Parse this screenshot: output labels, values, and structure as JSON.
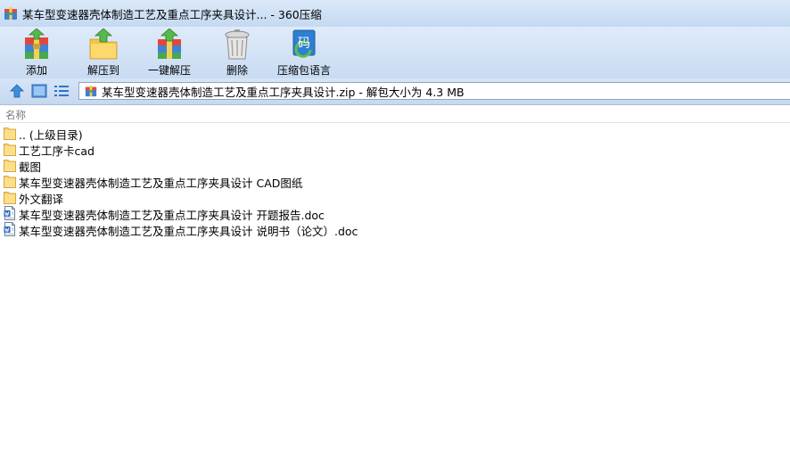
{
  "window": {
    "title": "某车型变速器壳体制造工艺及重点工序夹具设计... - 360压缩"
  },
  "toolbar": {
    "buttons": [
      {
        "label": "添加",
        "icon": "add-icon"
      },
      {
        "label": "解压到",
        "icon": "extract-to-icon"
      },
      {
        "label": "一键解压",
        "icon": "one-click-extract-icon"
      },
      {
        "label": "删除",
        "icon": "delete-icon"
      },
      {
        "label": "压缩包语言",
        "icon": "archive-language-icon",
        "icon_text": "码"
      }
    ]
  },
  "nav": {
    "address": "某车型变速器壳体制造工艺及重点工序夹具设计.zip - 解包大小为 4.3 MB"
  },
  "list": {
    "column_name": "名称",
    "items": [
      {
        "name": ".. (上级目录)",
        "type": "folder"
      },
      {
        "name": "工艺工序卡cad",
        "type": "folder"
      },
      {
        "name": "截图",
        "type": "folder"
      },
      {
        "name": "某车型变速器壳体制造工艺及重点工序夹具设计 CAD图纸",
        "type": "folder"
      },
      {
        "name": "外文翻译",
        "type": "folder"
      },
      {
        "name": "某车型变速器壳体制造工艺及重点工序夹具设计 开题报告.doc",
        "type": "doc"
      },
      {
        "name": "某车型变速器壳体制造工艺及重点工序夹具设计 说明书（论文）.doc",
        "type": "doc"
      }
    ]
  },
  "colors": {
    "toolbar_bg": "#d3e3f6",
    "folder": "#f5cf63",
    "accent_blue": "#2f7fd0"
  }
}
